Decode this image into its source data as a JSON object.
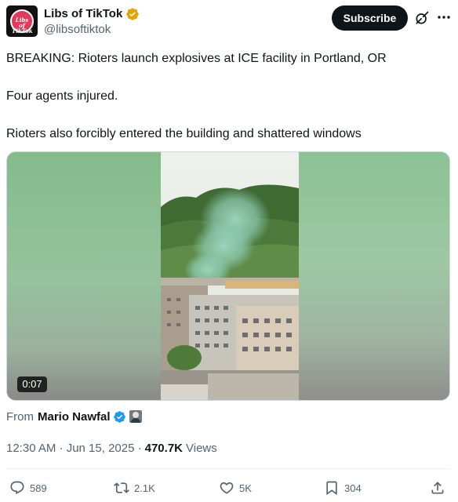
{
  "author": {
    "display_name": "Libs of TikTok",
    "handle": "@libsoftiktok",
    "avatar_text": "Libs of TikTok",
    "verified_badge": "gold-check",
    "badge_color": "#e8a200"
  },
  "header": {
    "subscribe_label": "Subscribe",
    "grok_icon": "grok-icon",
    "more_icon": "more-horizontal-icon"
  },
  "tweet": {
    "lines": [
      "BREAKING: Rioters launch explosives at ICE facility in Portland, OR",
      "Four agents injured.",
      "Rioters also forcibly entered the building and shattered windows"
    ]
  },
  "media": {
    "duration": "0:07"
  },
  "source": {
    "from_label": "From",
    "from_name": "Mario Nawfal",
    "badge_color": "#1d9bf0"
  },
  "meta": {
    "timestamp": "12:30 AM · Jun 15, 2025 ·",
    "views_count": "470.7K",
    "views_label": "Views"
  },
  "actions": {
    "replies": "589",
    "reposts": "2.1K",
    "likes": "5K",
    "bookmarks": "304"
  },
  "colors": {
    "text_primary": "#0f1419",
    "text_secondary": "#536471",
    "accent": "#1d9bf0",
    "button_dark": "#0f1419"
  }
}
